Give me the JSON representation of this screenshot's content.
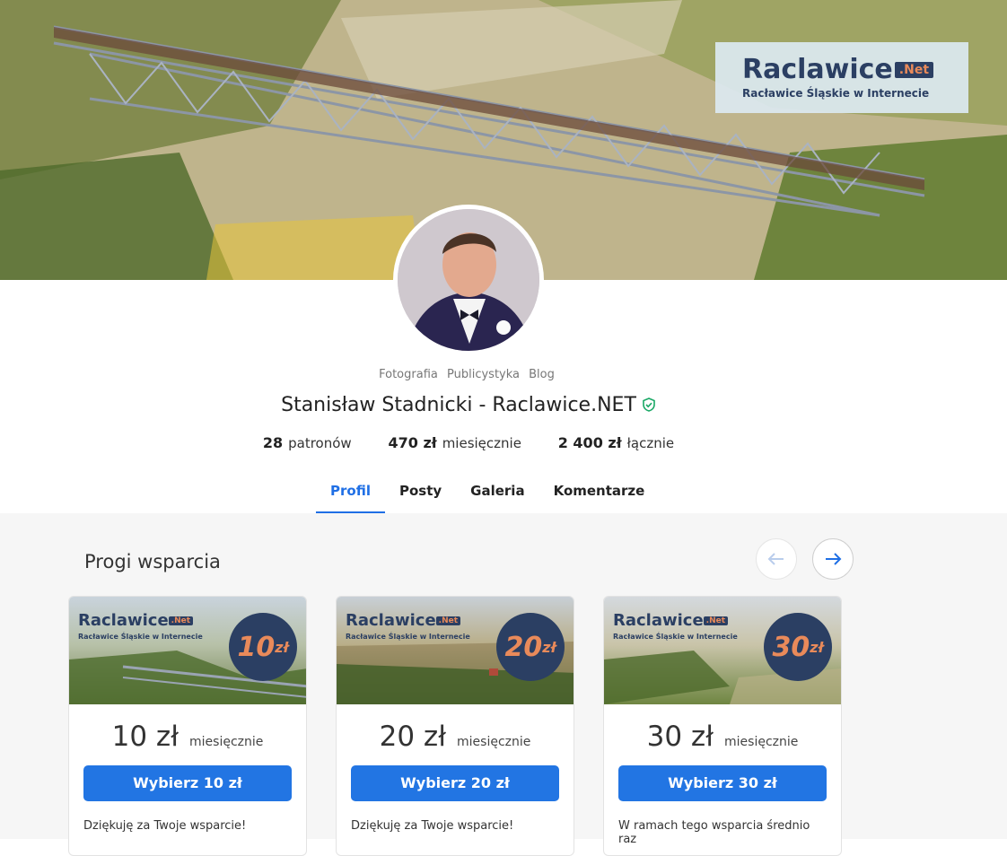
{
  "logo": {
    "main": "Raclawice",
    "net": ".Net",
    "tagline": "Racławice Śląskie w Internecie"
  },
  "profile": {
    "categories": [
      "Fotografia",
      "Publicystyka",
      "Blog"
    ],
    "name": "Stanisław Stadnicki - Raclawice.NET",
    "stats": [
      {
        "value": "28",
        "label": "patronów"
      },
      {
        "value": "470 zł",
        "label": "miesięcznie"
      },
      {
        "value": "2 400 zł",
        "label": "łącznie"
      }
    ]
  },
  "tabs": [
    "Profil",
    "Posty",
    "Galeria",
    "Komentarze"
  ],
  "tiers_section": {
    "title": "Progi wsparcia"
  },
  "tiers": [
    {
      "badge": "10",
      "badge_unit": "zł",
      "amount": "10 zł",
      "period": "miesięcznie",
      "button": "Wybierz 10 zł",
      "desc": "Dziękuję za Twoje wsparcie!"
    },
    {
      "badge": "20",
      "badge_unit": "zł",
      "amount": "20 zł",
      "period": "miesięcznie",
      "button": "Wybierz 20 zł",
      "desc": "Dziękuję za Twoje wsparcie!"
    },
    {
      "badge": "30",
      "badge_unit": "zł",
      "amount": "30 zł",
      "period": "miesięcznie",
      "button": "Wybierz 30 zł",
      "desc": "W ramach tego wsparcia średnio raz"
    }
  ],
  "colors": {
    "accent": "#1f6fe5",
    "button": "#2275e3",
    "brand_navy": "#2b3f63",
    "brand_orange": "#e98a5a",
    "verified": "#1aa866"
  }
}
